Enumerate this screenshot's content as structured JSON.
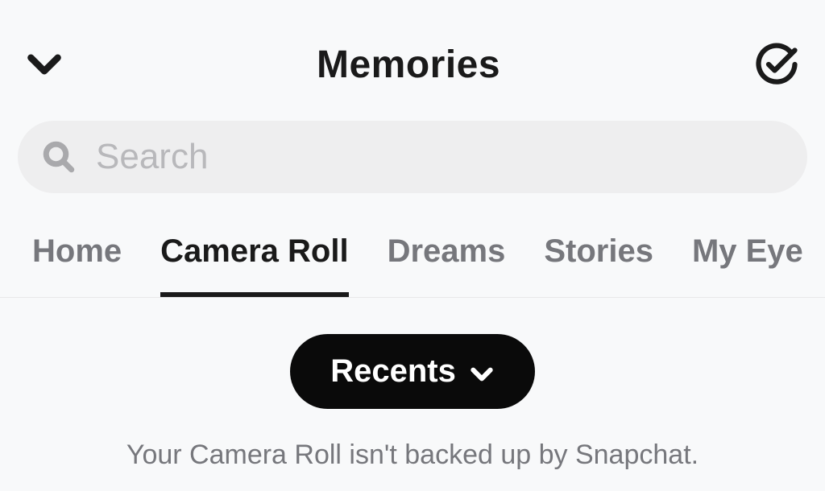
{
  "header": {
    "title": "Memories"
  },
  "search": {
    "placeholder": "Search"
  },
  "tabs": [
    {
      "label": "Home",
      "active": false
    },
    {
      "label": "Camera Roll",
      "active": true
    },
    {
      "label": "Dreams",
      "active": false
    },
    {
      "label": "Stories",
      "active": false
    },
    {
      "label": "My Eye",
      "active": false
    }
  ],
  "filter": {
    "label": "Recents"
  },
  "info": {
    "backup_message": "Your Camera Roll isn't backed up by Snapchat."
  }
}
